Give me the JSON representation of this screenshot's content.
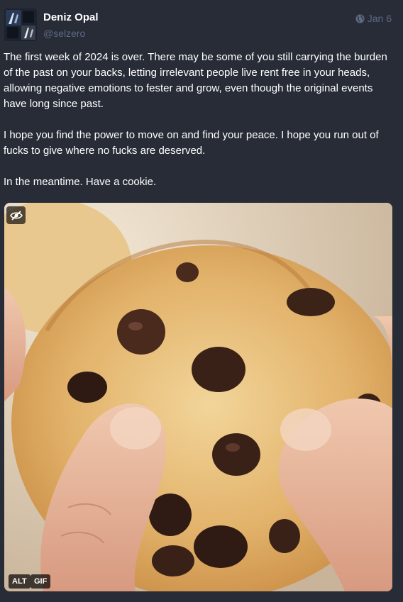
{
  "author": {
    "display_name": "Deniz Opal",
    "handle": "@selzero"
  },
  "meta": {
    "visibility_icon": "globe-icon",
    "date": "Jan 6"
  },
  "content": {
    "paragraphs": [
      "The first week of 2024 is over. There may be some of you still carrying the burden of the past on your backs, letting irrelevant people live rent free in your heads, allowing negative emotions to fester and grow, even though the original events have long since past.",
      "I hope you find the power to move on and find your peace. I hope you run out of fucks to give where no fucks are deserved.",
      "In the meantime. Have a cookie."
    ]
  },
  "media": {
    "hide_icon": "eye-slash-icon",
    "alt_badge": "ALT",
    "gif_badge": "GIF"
  },
  "colors": {
    "background": "#282c37",
    "muted_text": "#606984"
  }
}
